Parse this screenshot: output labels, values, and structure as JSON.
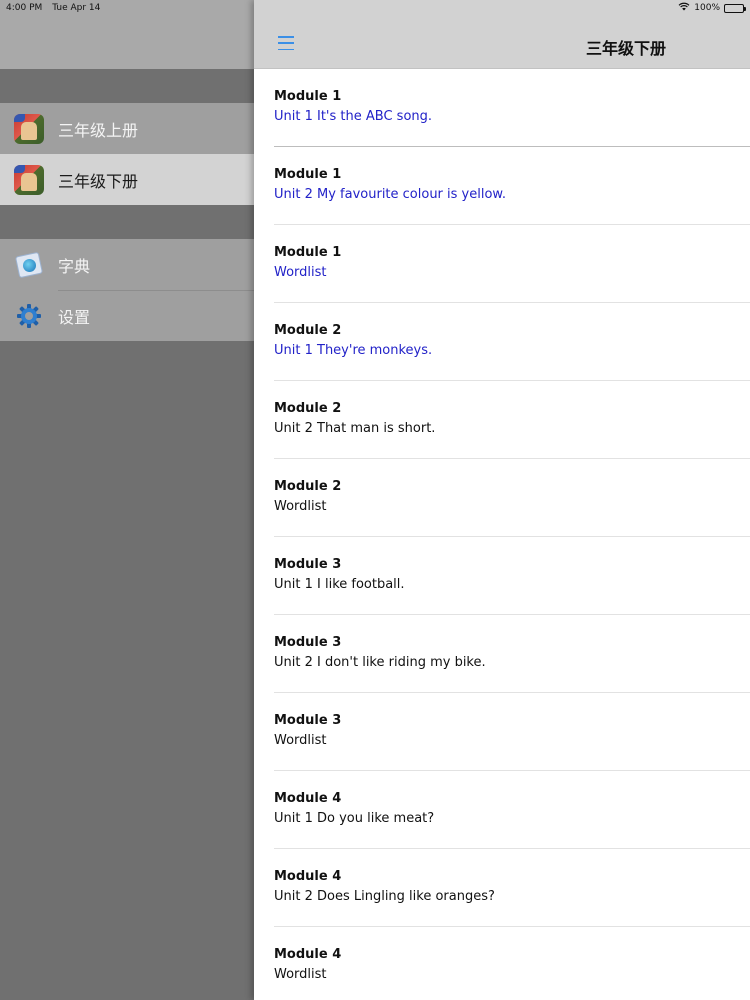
{
  "status_bar": {
    "time": "4:00 PM",
    "date": "Tue Apr 14",
    "battery": "100%"
  },
  "sidebar": {
    "books": [
      {
        "label": "三年级上册",
        "icon": "textbook-cover-icon",
        "selected": false
      },
      {
        "label": "三年级下册",
        "icon": "textbook-cover-icon",
        "selected": true
      }
    ],
    "tools": [
      {
        "label": "字典",
        "icon": "dictionary-icon"
      },
      {
        "label": "设置",
        "icon": "gear-icon"
      }
    ]
  },
  "navbar": {
    "title": "三年级下册",
    "menu_icon": "hamburger-menu-icon"
  },
  "units": [
    {
      "module": "Module 1",
      "unit": "Unit 1 It's the ABC song.",
      "available": true
    },
    {
      "module": "Module 1",
      "unit": "Unit 2 My favourite colour is yellow.",
      "available": true
    },
    {
      "module": "Module 1",
      "unit": "Wordlist",
      "available": true
    },
    {
      "module": "Module 2",
      "unit": "Unit 1 They're monkeys.",
      "available": true
    },
    {
      "module": "Module 2",
      "unit": "Unit 2 That man is short.",
      "available": false
    },
    {
      "module": "Module 2",
      "unit": "Wordlist",
      "available": false
    },
    {
      "module": "Module 3",
      "unit": "Unit 1 I like football.",
      "available": false
    },
    {
      "module": "Module 3",
      "unit": "Unit 2 I don't like riding my bike.",
      "available": false
    },
    {
      "module": "Module 3",
      "unit": "Wordlist",
      "available": false
    },
    {
      "module": "Module 4",
      "unit": "Unit 1 Do you like meat?",
      "available": false
    },
    {
      "module": "Module 4",
      "unit": "Unit 2 Does Lingling like oranges?",
      "available": false
    },
    {
      "module": "Module 4",
      "unit": "Wordlist",
      "available": false
    }
  ],
  "colors": {
    "available_link": "#2222c8",
    "menu_icon": "#3b8fe6"
  }
}
